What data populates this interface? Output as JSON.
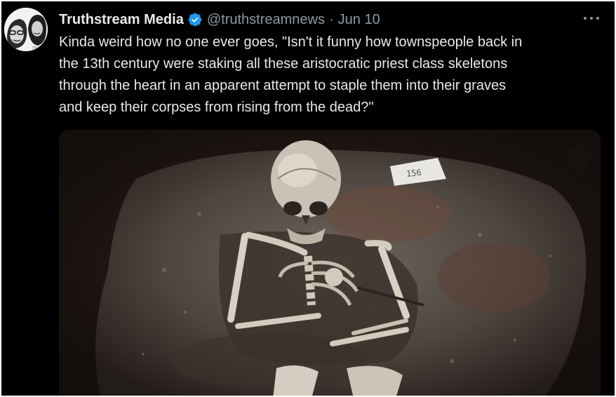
{
  "tweet": {
    "display_name": "Truthstream Media",
    "handle": "@truthstreamnews",
    "separator": "·",
    "date": "Jun 10",
    "text": "Kinda weird how no one ever goes, \"Isn't it funny how townspeople back in\nthe 13th century were staking all these aristocratic priest class skeletons\nthrough the heart in an apparent attempt to staple them into their graves\nand keep their corpses from rising from the dead?\""
  },
  "avatar": {
    "badge_text": "TSN"
  },
  "media": {
    "marker_label": "156"
  },
  "icons": {
    "verified": "verified-badge-icon",
    "more": "more-options-icon"
  },
  "colors": {
    "background": "#000000",
    "text": "#e7e9ea",
    "muted": "#8b98a5",
    "verified": "#1d9bf0"
  }
}
